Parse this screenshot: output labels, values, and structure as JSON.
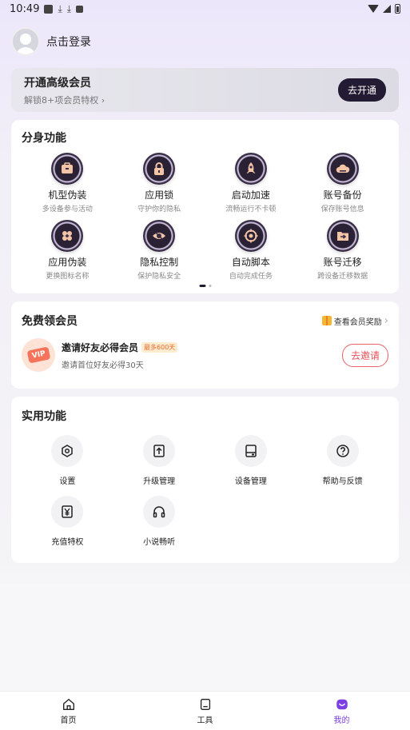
{
  "status_bar": {
    "time": "10:49"
  },
  "user": {
    "login_text": "点击登录"
  },
  "vip_banner": {
    "title": "开通高级会员",
    "subtitle": "解锁8+项会员特权",
    "button": "去开通"
  },
  "clone": {
    "title": "分身功能",
    "items": [
      {
        "label": "机型伪装",
        "desc": "多设备参与活动",
        "icon": "briefcase-icon"
      },
      {
        "label": "应用锁",
        "desc": "守护你的隐私",
        "icon": "lock-icon"
      },
      {
        "label": "启动加速",
        "desc": "流畅运行不卡顿",
        "icon": "rocket-icon"
      },
      {
        "label": "账号备份",
        "desc": "保存账号信息",
        "icon": "cloud-icon"
      },
      {
        "label": "应用伪装",
        "desc": "更换图标名称",
        "icon": "apps-icon"
      },
      {
        "label": "隐私控制",
        "desc": "保护隐私安全",
        "icon": "eye-icon"
      },
      {
        "label": "自动脚本",
        "desc": "自动完成任务",
        "icon": "target-icon"
      },
      {
        "label": "账号迁移",
        "desc": "跨设备迁移数据",
        "icon": "folder-transfer-icon"
      }
    ]
  },
  "free_vip": {
    "title": "免费领会员",
    "reward_link": "查看会员奖励",
    "vip_tag": "VIP",
    "invite_title": "邀请好友必得会员",
    "max_badge": "最多600天",
    "invite_sub": "邀请首位好友必得30天",
    "invite_button": "去邀请"
  },
  "utilities": {
    "title": "实用功能",
    "items": [
      {
        "label": "设置",
        "icon": "settings-icon"
      },
      {
        "label": "升级管理",
        "icon": "upgrade-icon"
      },
      {
        "label": "设备管理",
        "icon": "device-icon"
      },
      {
        "label": "帮助与反馈",
        "icon": "help-icon"
      },
      {
        "label": "充值特权",
        "icon": "yen-icon"
      },
      {
        "label": "小说畅听",
        "icon": "headphones-icon"
      }
    ]
  },
  "tabs": [
    {
      "label": "首页",
      "icon": "home-icon"
    },
    {
      "label": "工具",
      "icon": "tools-icon"
    },
    {
      "label": "我的",
      "icon": "profile-icon",
      "active": true
    }
  ],
  "colors": {
    "accent": "#7b3fe4",
    "dark": "#231b33",
    "invite": "#e8505a"
  }
}
